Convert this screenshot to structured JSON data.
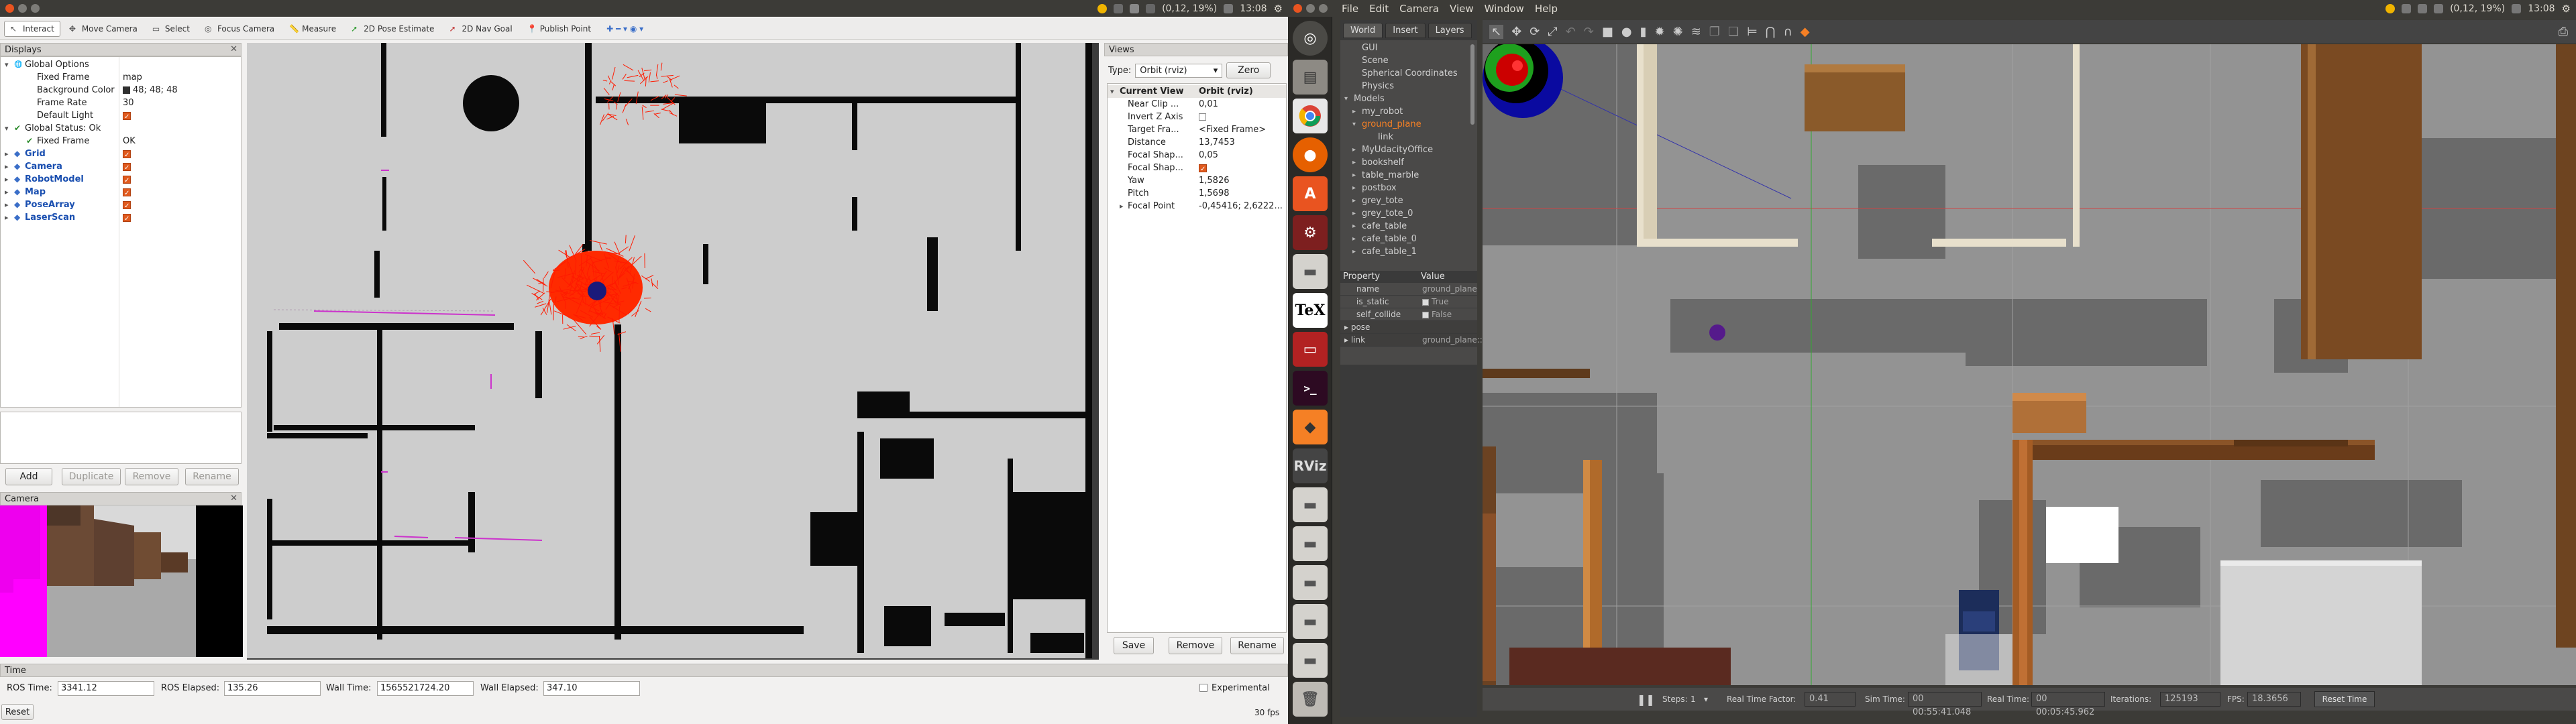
{
  "rviz": {
    "tray": {
      "coords": "(0,12, 19%)",
      "time": "13:08"
    },
    "toolbar": [
      {
        "label": "Interact",
        "icon": "cursor-icon",
        "active": true
      },
      {
        "label": "Move Camera",
        "icon": "move-camera-icon"
      },
      {
        "label": "Select",
        "icon": "select-icon"
      },
      {
        "label": "Focus Camera",
        "icon": "focus-camera-icon"
      },
      {
        "label": "Measure",
        "icon": "measure-icon"
      },
      {
        "label": "2D Pose Estimate",
        "icon": "pose-estimate-icon"
      },
      {
        "label": "2D Nav Goal",
        "icon": "nav-goal-icon"
      },
      {
        "label": "Publish Point",
        "icon": "publish-point-icon"
      }
    ],
    "displays": {
      "title": "Displays",
      "rows": [
        {
          "name": "Global Options",
          "value": "",
          "indent": 1,
          "expand": "▾",
          "kind": "globe"
        },
        {
          "name": "Fixed Frame",
          "value": "map",
          "indent": 2
        },
        {
          "name": "Background Color",
          "value": "48; 48; 48",
          "indent": 2,
          "swatch": "#303030"
        },
        {
          "name": "Frame Rate",
          "value": "30",
          "indent": 2
        },
        {
          "name": "Default Light",
          "value": "",
          "indent": 2,
          "check": true
        },
        {
          "name": "Global Status: Ok",
          "value": "",
          "indent": 1,
          "expand": "▾",
          "kind": "ok"
        },
        {
          "name": "Fixed Frame",
          "value": "OK",
          "indent": 2,
          "kind": "ok"
        },
        {
          "name": "Grid",
          "value": "",
          "indent": 1,
          "expand": "▸",
          "check": true,
          "blue": true
        },
        {
          "name": "Camera",
          "value": "",
          "indent": 1,
          "expand": "▸",
          "check": true,
          "blue": true
        },
        {
          "name": "RobotModel",
          "value": "",
          "indent": 1,
          "expand": "▸",
          "check": true,
          "blue": true
        },
        {
          "name": "Map",
          "value": "",
          "indent": 1,
          "expand": "▸",
          "check": true,
          "blue": true
        },
        {
          "name": "PoseArray",
          "value": "",
          "indent": 1,
          "expand": "▸",
          "check": true,
          "blue": true
        },
        {
          "name": "LaserScan",
          "value": "",
          "indent": 1,
          "expand": "▸",
          "check": true,
          "blue": true
        }
      ],
      "buttons": [
        "Add",
        "Duplicate",
        "Remove",
        "Rename"
      ]
    },
    "camera": {
      "title": "Camera"
    },
    "views": {
      "title": "Views",
      "type_label": "Type:",
      "type_value": "Orbit (rviz)",
      "zero": "Zero",
      "rows": [
        {
          "name": "Current View",
          "value": "Orbit (rviz)",
          "head": true
        },
        {
          "name": "Near Clip ...",
          "value": "0,01"
        },
        {
          "name": "Invert Z Axis",
          "value": "",
          "box": true
        },
        {
          "name": "Target Fra...",
          "value": "<Fixed Frame>"
        },
        {
          "name": "Distance",
          "value": "13,7453"
        },
        {
          "name": "Focal Shap...",
          "value": "0,05"
        },
        {
          "name": "Focal Shap...",
          "value": "",
          "check": true
        },
        {
          "name": "Yaw",
          "value": "1,5826"
        },
        {
          "name": "Pitch",
          "value": "1,5698"
        },
        {
          "name": "Focal Point",
          "value": "-0,45416; 2,6222...",
          "expand": true
        }
      ],
      "buttons": [
        "Save",
        "Remove",
        "Rename"
      ]
    },
    "time": {
      "title": "Time",
      "ros_time_label": "ROS Time:",
      "ros_time": "3341.12",
      "ros_elapsed_label": "ROS Elapsed:",
      "ros_elapsed": "135.26",
      "wall_time_label": "Wall Time:",
      "wall_time": "1565521724.20",
      "wall_elapsed_label": "Wall Elapsed:",
      "wall_elapsed": "347.10",
      "experimental": "Experimental",
      "reset": "Reset",
      "fps": "30 fps"
    }
  },
  "gazebo": {
    "menu": [
      "File",
      "Edit",
      "Camera",
      "View",
      "Window",
      "Help"
    ],
    "tray": {
      "coords": "(0,12, 19%)",
      "time": "13:08"
    },
    "tabs": [
      "World",
      "Insert",
      "Layers"
    ],
    "world_tree": [
      {
        "label": "GUI",
        "indent": 1
      },
      {
        "label": "Scene",
        "indent": 1
      },
      {
        "label": "Spherical Coordinates",
        "indent": 1
      },
      {
        "label": "Physics",
        "indent": 1
      },
      {
        "label": "Models",
        "indent": 0,
        "expand": "▾"
      },
      {
        "label": "my_robot",
        "indent": 1,
        "expand": "▸"
      },
      {
        "label": "ground_plane",
        "indent": 1,
        "expand": "▾",
        "selected": true
      },
      {
        "label": "link",
        "indent": 3
      },
      {
        "label": "MyUdacityOffice",
        "indent": 1,
        "expand": "▸"
      },
      {
        "label": "bookshelf",
        "indent": 1,
        "expand": "▸"
      },
      {
        "label": "table_marble",
        "indent": 1,
        "expand": "▸"
      },
      {
        "label": "postbox",
        "indent": 1,
        "expand": "▸"
      },
      {
        "label": "grey_tote",
        "indent": 1,
        "expand": "▸"
      },
      {
        "label": "grey_tote_0",
        "indent": 1,
        "expand": "▸"
      },
      {
        "label": "cafe_table",
        "indent": 1,
        "expand": "▸"
      },
      {
        "label": "cafe_table_0",
        "indent": 1,
        "expand": "▸"
      },
      {
        "label": "cafe_table_1",
        "indent": 1,
        "expand": "▸"
      }
    ],
    "props": {
      "header": [
        "Property",
        "Value"
      ],
      "rows": [
        {
          "name": "name",
          "value": "ground_plane"
        },
        {
          "name": "is_static",
          "value": "True",
          "box": true
        },
        {
          "name": "self_collide",
          "value": "False",
          "box": true
        },
        {
          "name": "pose",
          "value": "",
          "expand": "▸"
        },
        {
          "name": "link",
          "value": "ground_plane::link",
          "expand": "▸"
        }
      ]
    },
    "bottom": {
      "steps_label": "Steps:",
      "steps": "1",
      "rtf_label": "Real Time Factor:",
      "rtf": "0.41",
      "sim_label": "Sim Time:",
      "sim": "00 00:55:41.048",
      "real_label": "Real Time:",
      "real": "00 00:05:45.962",
      "iter_label": "Iterations:",
      "iter": "125193",
      "fps_label": "FPS:",
      "fps": "18.3656",
      "reset_label": "Reset Time"
    }
  }
}
